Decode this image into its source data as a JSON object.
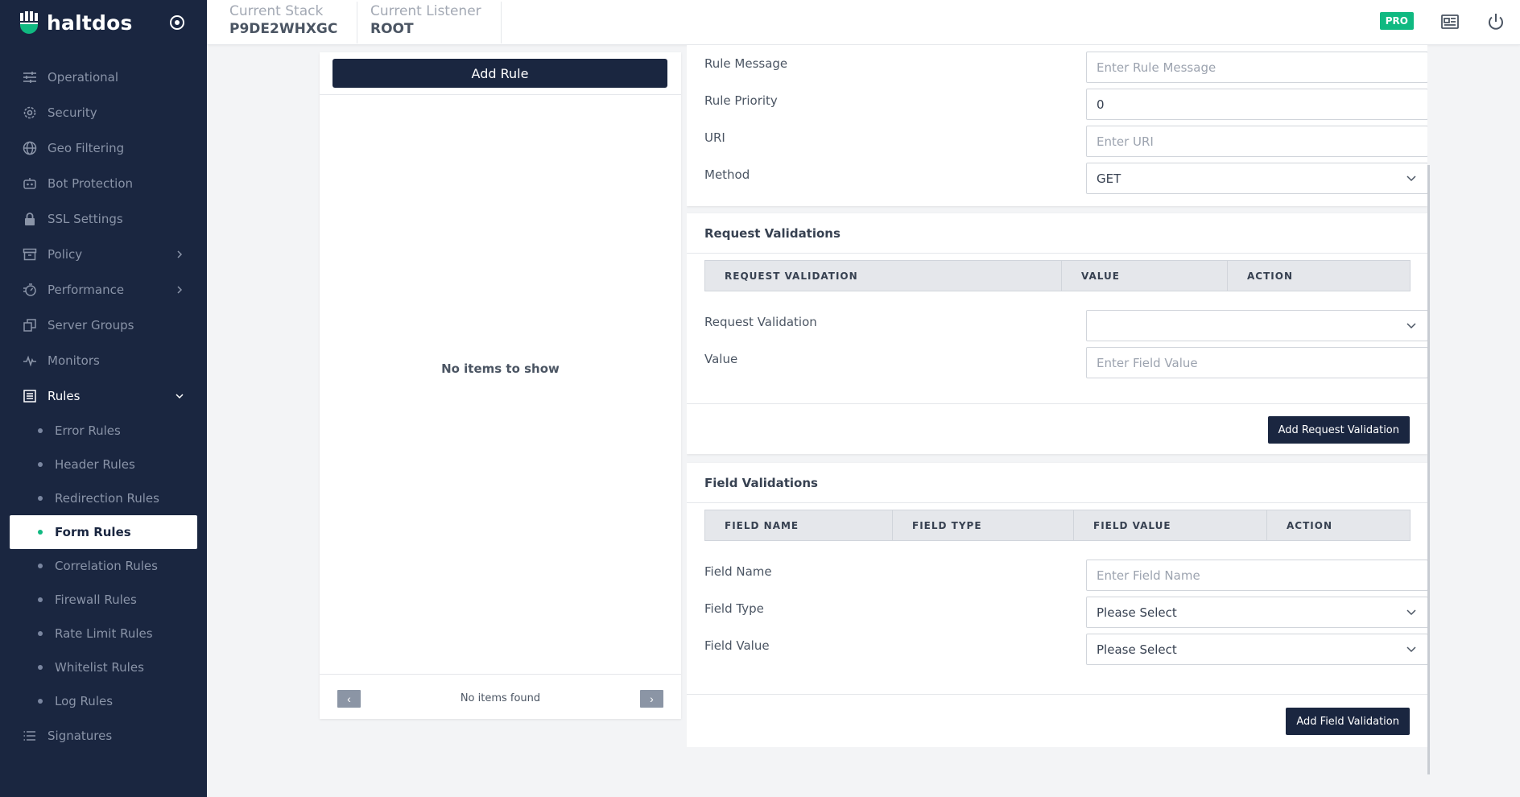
{
  "brand": {
    "name": "haltdos"
  },
  "topbar": {
    "stack_label": "Current Stack",
    "stack_value": "P9DE2WHXGC",
    "listener_label": "Current Listener",
    "listener_value": "ROOT",
    "badge": "PRO"
  },
  "sidebar": {
    "items": [
      {
        "label": "Operational",
        "icon": "sliders-icon"
      },
      {
        "label": "Security",
        "icon": "gear-icon"
      },
      {
        "label": "Geo Filtering",
        "icon": "globe-icon"
      },
      {
        "label": "Bot Protection",
        "icon": "bot-icon"
      },
      {
        "label": "SSL Settings",
        "icon": "lock-icon"
      },
      {
        "label": "Policy",
        "icon": "archive-icon"
      },
      {
        "label": "Performance",
        "icon": "speed-icon"
      },
      {
        "label": "Server Groups",
        "icon": "copy-icon"
      },
      {
        "label": "Monitors",
        "icon": "pulse-icon"
      },
      {
        "label": "Rules",
        "icon": "list-box-icon"
      }
    ],
    "subitems": [
      "Error Rules",
      "Header Rules",
      "Redirection Rules",
      "Form Rules",
      "Correlation Rules",
      "Firewall Rules",
      "Rate Limit Rules",
      "Whitelist Rules",
      "Log Rules"
    ],
    "signatures": "Signatures"
  },
  "left_panel": {
    "add_rule": "Add Rule",
    "empty_message": "No items to show",
    "pagination_info": "No items found",
    "prev": "‹",
    "next": "›"
  },
  "rule_form": {
    "rule_message_label": "Rule Message",
    "rule_message_placeholder": "Enter Rule Message",
    "rule_priority_label": "Rule Priority",
    "rule_priority_value": "0",
    "uri_label": "URI",
    "uri_placeholder": "Enter URI",
    "method_label": "Method",
    "method_value": "GET"
  },
  "request_validations": {
    "title": "Request Validations",
    "columns": [
      "REQUEST VALIDATION",
      "VALUE",
      "ACTION"
    ],
    "request_validation_label": "Request Validation",
    "request_validation_value": "",
    "value_label": "Value",
    "value_placeholder": "Enter Field Value",
    "add_button": "Add Request Validation"
  },
  "field_validations": {
    "title": "Field Validations",
    "columns": [
      "FIELD NAME",
      "FIELD TYPE",
      "FIELD VALUE",
      "ACTION"
    ],
    "field_name_label": "Field Name",
    "field_name_placeholder": "Enter Field Name",
    "field_type_label": "Field Type",
    "field_type_value": "Please Select",
    "field_value_label": "Field Value",
    "field_value_value": "Please Select",
    "add_button": "Add Field Validation"
  }
}
